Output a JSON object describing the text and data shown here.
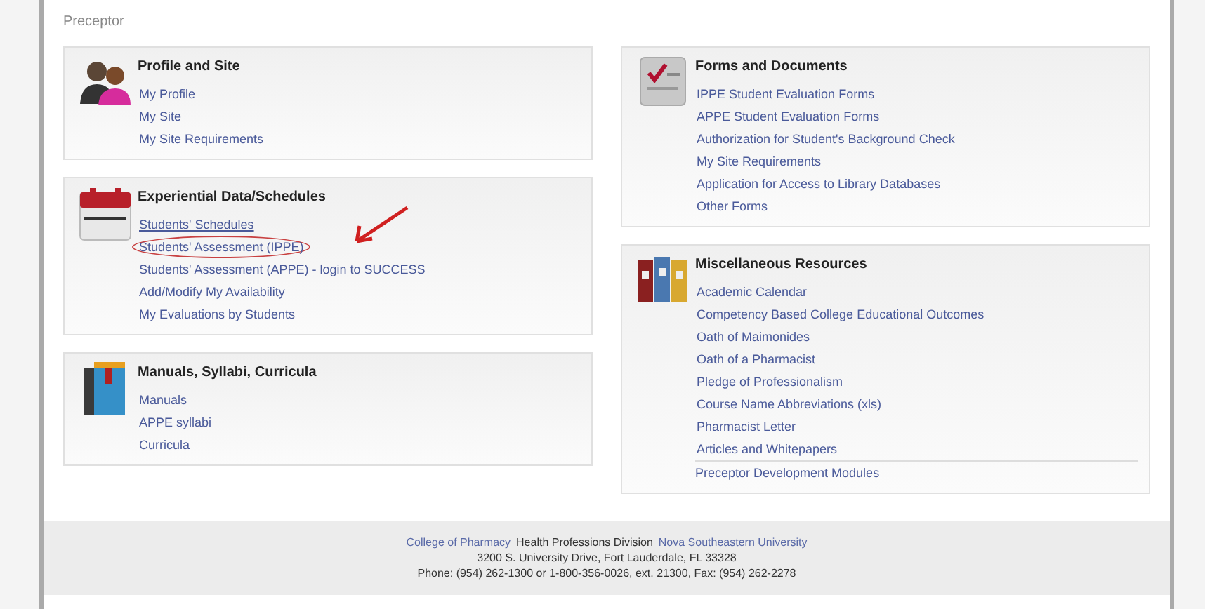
{
  "section_title": "Preceptor",
  "columns": [
    [
      {
        "title": "Profile and Site",
        "kind": "people",
        "links": [
          {
            "text": "My Profile",
            "circled": false
          },
          {
            "text": "My Site",
            "circled": false
          },
          {
            "text": "My Site Requirements",
            "circled": false
          }
        ]
      },
      {
        "title": "Experiential Data/Schedules",
        "kind": "calendar",
        "links": [
          {
            "text": "Students' Schedules",
            "circled": false,
            "underlined": true
          },
          {
            "text": "Students' Assessment (IPPE)",
            "circled": true
          },
          {
            "text": "Students' Assessment (APPE) - login to SUCCESS",
            "circled": false
          },
          {
            "text": "Add/Modify My Availability",
            "circled": false
          },
          {
            "text": "My Evaluations by Students",
            "circled": false
          }
        ]
      },
      {
        "title": "Manuals, Syllabi, Curricula",
        "kind": "book",
        "links": [
          {
            "text": "Manuals",
            "circled": false
          },
          {
            "text": "APPE syllabi",
            "circled": false
          },
          {
            "text": "Curricula",
            "circled": false
          }
        ]
      }
    ],
    [
      {
        "title": "Forms and Documents",
        "kind": "checklist",
        "links": [
          {
            "text": "IPPE Student Evaluation Forms",
            "circled": false
          },
          {
            "text": "APPE Student Evaluation Forms",
            "circled": false
          },
          {
            "text": "Authorization for Student's Background Check",
            "circled": false
          },
          {
            "text": "My Site Requirements",
            "circled": false
          },
          {
            "text": "Application for Access to Library Databases",
            "circled": false
          },
          {
            "text": "Other Forms",
            "circled": false
          }
        ]
      },
      {
        "title": "Miscellaneous Resources",
        "kind": "binders",
        "links": [
          {
            "text": "Academic Calendar",
            "circled": false
          },
          {
            "text": "Competency Based College Educational Outcomes",
            "circled": false
          },
          {
            "text": "Oath of Maimonides",
            "circled": false
          },
          {
            "text": "Oath of a Pharmacist",
            "circled": false
          },
          {
            "text": "Pledge of Professionalism",
            "circled": false
          },
          {
            "text": "Course Name Abbreviations (xls)",
            "circled": false
          },
          {
            "text": "Pharmacist Letter",
            "circled": false
          },
          {
            "text": "Articles and Whitepapers",
            "circled": false
          }
        ],
        "footer_link": "Preceptor Development Modules"
      }
    ]
  ],
  "footer": {
    "line1": [
      {
        "text": "College of Pharmacy",
        "kind": "link"
      },
      {
        "text": "Health Professions Division",
        "kind": "text"
      },
      {
        "text": "Nova Southeastern University",
        "kind": "link"
      }
    ],
    "line2": "3200 S. University Drive, Fort Lauderdale, FL 33328",
    "line3": "Phone: (954) 262-1300 or 1-800-356-0026, ext. 21300, Fax: (954) 262-2278"
  }
}
